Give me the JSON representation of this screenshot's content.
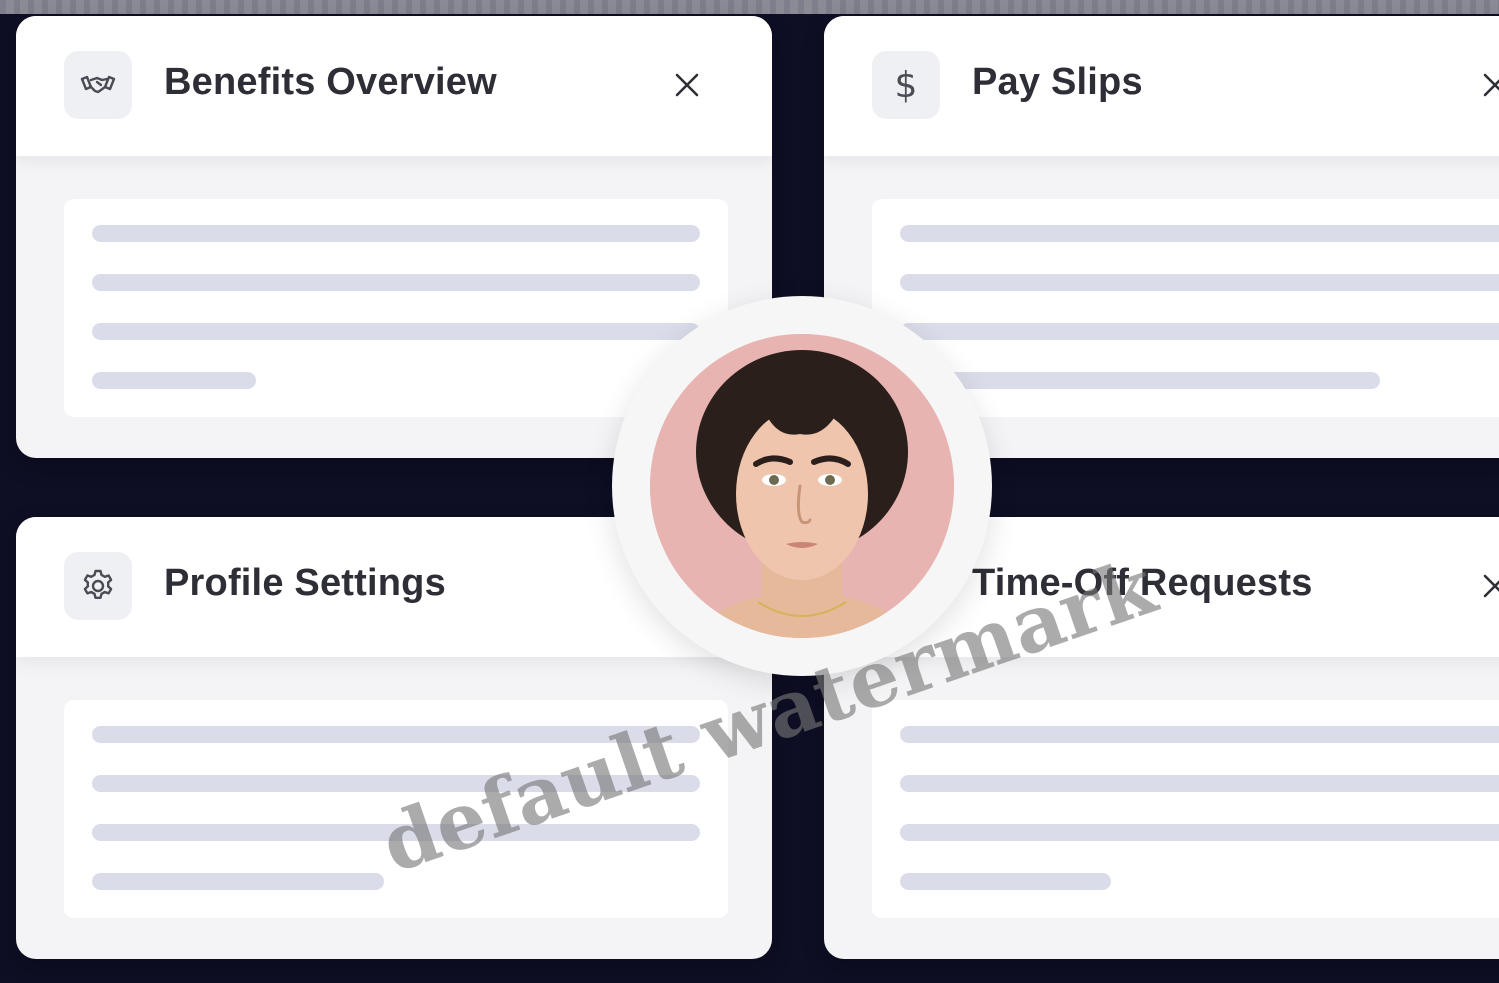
{
  "cards": [
    {
      "title": "Benefits Overview",
      "icon": "handshake-icon",
      "bars": [
        1,
        1,
        1,
        0.27
      ]
    },
    {
      "title": "Pay Slips",
      "icon": "dollar-icon",
      "bars": [
        1,
        1,
        1,
        0.75
      ]
    },
    {
      "title": "Profile Settings",
      "icon": "gear-icon",
      "bars": [
        1,
        1,
        1,
        0.48
      ]
    },
    {
      "title": "Time-Off Requests",
      "icon": "calendar-icon",
      "bars": [
        1,
        1,
        1,
        0.33
      ]
    }
  ],
  "watermark": "default watermark",
  "colors": {
    "card_background": "#f4f4f6",
    "header_background": "#ffffff",
    "skeleton_bar": "#dadce9",
    "title_text": "#2e2f36",
    "avatar_background": "#e7b3b0",
    "backdrop": "#0e0e24"
  }
}
